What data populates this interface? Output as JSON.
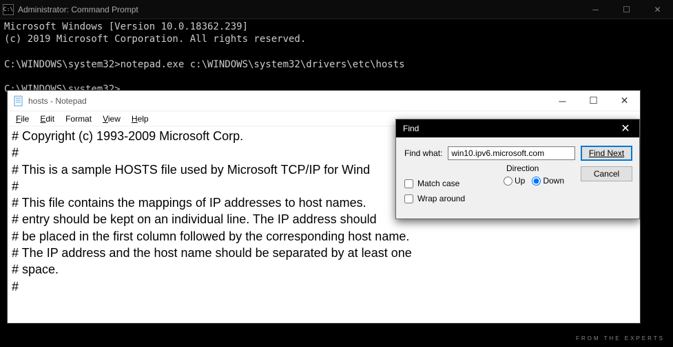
{
  "cmd": {
    "title": "Administrator: Command Prompt",
    "icon_text": "C:\\",
    "lines": "Microsoft Windows [Version 10.0.18362.239]\n(c) 2019 Microsoft Corporation. All rights reserved.\n\nC:\\WINDOWS\\system32>notepad.exe c:\\WINDOWS\\system32\\drivers\\etc\\hosts\n\nC:\\WINDOWS\\system32>"
  },
  "notepad": {
    "title": "hosts - Notepad",
    "menu": {
      "file": "File",
      "edit": "Edit",
      "format": "Format",
      "view": "View",
      "help": "Help"
    },
    "content": "# Copyright (c) 1993-2009 Microsoft Corp.\n#\n# This is a sample HOSTS file used by Microsoft TCP/IP for Wind\n#\n# This file contains the mappings of IP addresses to host names.\n# entry should be kept on an individual line. The IP address should\n# be placed in the first column followed by the corresponding host name.\n# The IP address and the host name should be separated by at least one\n# space.\n#"
  },
  "find": {
    "title": "Find",
    "label_find_what": "Find what:",
    "value": "win10.ipv6.microsoft.com",
    "btn_find_next": "Find Next",
    "btn_cancel": "Cancel",
    "chk_match_case": "Match case",
    "chk_wrap": "Wrap around",
    "direction_label": "Direction",
    "radio_up": "Up",
    "radio_down": "Down"
  },
  "watermark": {
    "tag": "FROM THE EXPERTS"
  }
}
